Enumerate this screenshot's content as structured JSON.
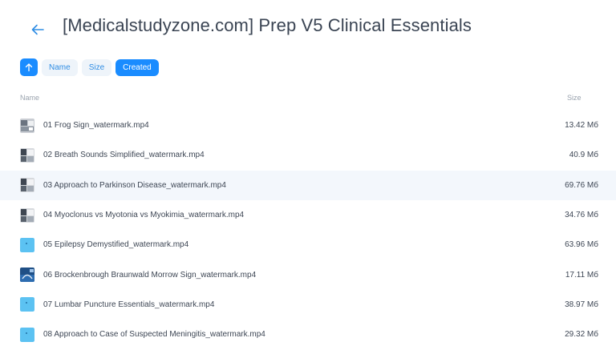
{
  "header": {
    "title": "[Medicalstudyzone.com] Prep V5 Clinical Essentials",
    "back_icon": "arrow-left-icon"
  },
  "sort": {
    "direction_icon": "arrow-up-icon",
    "options": [
      {
        "label": "Name",
        "active": false
      },
      {
        "label": "Size",
        "active": false
      },
      {
        "label": "Created",
        "active": true
      }
    ]
  },
  "columns": {
    "name": "Name",
    "size": "Size"
  },
  "colors": {
    "accent": "#1a8cff",
    "row_highlight": "#f3f7fc"
  },
  "files": [
    {
      "name": "01 Frog Sign_watermark.mp4",
      "size": "13.42 Мб",
      "thumb": "video-frame-icon"
    },
    {
      "name": "02 Breath Sounds Simplified_watermark.mp4",
      "size": "40.9 Мб",
      "thumb": "video-frame-icon"
    },
    {
      "name": "03 Approach to Parkinson Disease_watermark.mp4",
      "size": "69.76 Мб",
      "thumb": "video-frame-icon"
    },
    {
      "name": "04 Myoclonus vs Myotonia vs Myokimia_watermark.mp4",
      "size": "34.76 Мб",
      "thumb": "video-frame-icon"
    },
    {
      "name": "05 Epilepsy Demystified_watermark.mp4",
      "size": "63.96 Мб",
      "thumb": "video-file-icon"
    },
    {
      "name": "06 Brockenbrough Braunwald Morrow Sign_watermark.mp4",
      "size": "17.11 Мб",
      "thumb": "video-frame-icon"
    },
    {
      "name": "07 Lumbar Puncture Essentials_watermark.mp4",
      "size": "38.97 Мб",
      "thumb": "video-file-icon"
    },
    {
      "name": "08 Approach to Case of Suspected Meningitis_watermark.mp4",
      "size": "29.32 Мб",
      "thumb": "video-file-icon"
    }
  ]
}
